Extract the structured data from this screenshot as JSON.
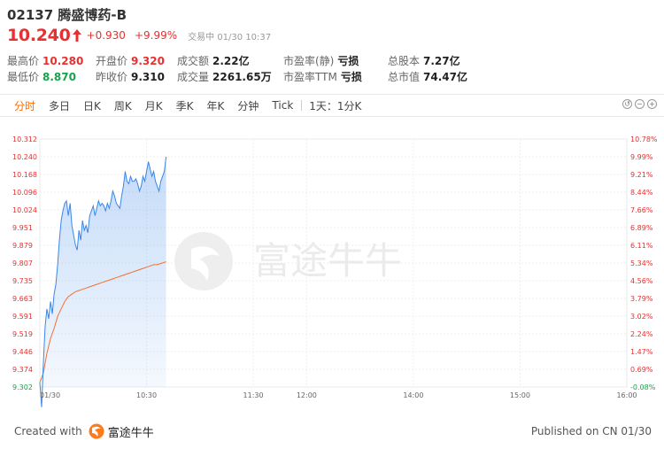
{
  "stock": {
    "code": "02137",
    "name": "腾盛博药-B",
    "price": "10.240",
    "change": "+0.930",
    "change_pct": "+9.99%",
    "status": "交易中 01/30 10:37"
  },
  "stats": {
    "high_label": "最高价",
    "high": "10.280",
    "open_label": "开盘价",
    "open": "9.320",
    "turnover_label": "成交额",
    "turnover": "2.22亿",
    "pe_static_label": "市盈率(静)",
    "pe_static": "亏损",
    "shares_label": "总股本",
    "shares": "7.27亿",
    "low_label": "最低价",
    "low": "8.870",
    "prev_close_label": "昨收价",
    "prev_close": "9.310",
    "volume_label": "成交量",
    "volume": "2261.65万",
    "pe_ttm_label": "市盈率TTM",
    "pe_ttm": "亏损",
    "mktcap_label": "总市值",
    "mktcap": "74.47亿"
  },
  "tabs": [
    {
      "label": "分时",
      "active": true
    },
    {
      "label": "多日"
    },
    {
      "label": "日K"
    },
    {
      "label": "周K"
    },
    {
      "label": "月K"
    },
    {
      "label": "季K"
    },
    {
      "label": "年K"
    },
    {
      "label": "分钟"
    },
    {
      "label": "Tick"
    }
  ],
  "interval_label": "1天：1分K",
  "watermark": "富途牛牛",
  "footer": {
    "created_with": "Created with",
    "brand": "富途牛牛",
    "published": "Published on CN 01/30"
  },
  "colors": {
    "up": "#e83030",
    "down": "#17a34a",
    "price_line": "#3a86e8",
    "avg_line": "#f07030",
    "accent": "#ff6a00"
  },
  "chart_data": {
    "type": "line",
    "left_ticks": [
      "10.312",
      "10.240",
      "10.168",
      "10.096",
      "10.024",
      "9.951",
      "9.879",
      "9.807",
      "9.735",
      "9.663",
      "9.591",
      "9.519",
      "9.446",
      "9.374",
      "9.302"
    ],
    "right_ticks": [
      "10.78%",
      "9.99%",
      "9.21%",
      "8.44%",
      "7.66%",
      "6.89%",
      "6.11%",
      "5.34%",
      "4.56%",
      "3.79%",
      "3.02%",
      "2.24%",
      "1.47%",
      "0.69%",
      "-0.08%"
    ],
    "x_ticks": [
      "01/30",
      "10:30",
      "11:30",
      "12:00",
      "14:00",
      "15:00",
      "16:00"
    ],
    "ylim": [
      9.302,
      10.312
    ],
    "series": [
      {
        "type": "price",
        "points": [
          [
            0,
            9.32
          ],
          [
            1,
            9.22
          ],
          [
            2,
            9.4
          ],
          [
            3,
            9.55
          ],
          [
            4,
            9.62
          ],
          [
            5,
            9.58
          ],
          [
            6,
            9.65
          ],
          [
            7,
            9.6
          ],
          [
            8,
            9.68
          ],
          [
            9,
            9.72
          ],
          [
            10,
            9.8
          ],
          [
            11,
            9.9
          ],
          [
            12,
            9.98
          ],
          [
            13,
            10.02
          ],
          [
            14,
            10.05
          ],
          [
            15,
            10.06
          ],
          [
            16,
            10.0
          ],
          [
            17,
            10.05
          ],
          [
            18,
            9.96
          ],
          [
            19,
            9.92
          ],
          [
            20,
            9.88
          ],
          [
            21,
            9.86
          ],
          [
            22,
            9.94
          ],
          [
            23,
            9.9
          ],
          [
            24,
            9.98
          ],
          [
            25,
            9.94
          ],
          [
            26,
            9.96
          ],
          [
            27,
            9.93
          ],
          [
            28,
            10.0
          ],
          [
            29,
            10.02
          ],
          [
            30,
            10.04
          ],
          [
            31,
            10.0
          ],
          [
            32,
            10.03
          ],
          [
            33,
            10.06
          ],
          [
            34,
            10.04
          ],
          [
            35,
            10.05
          ],
          [
            36,
            10.04
          ],
          [
            37,
            10.02
          ],
          [
            38,
            10.05
          ],
          [
            39,
            10.03
          ],
          [
            40,
            10.06
          ],
          [
            41,
            10.1
          ],
          [
            42,
            10.08
          ],
          [
            43,
            10.05
          ],
          [
            44,
            10.04
          ],
          [
            45,
            10.03
          ],
          [
            46,
            10.08
          ],
          [
            47,
            10.12
          ],
          [
            48,
            10.18
          ],
          [
            49,
            10.14
          ],
          [
            50,
            10.13
          ],
          [
            51,
            10.16
          ],
          [
            52,
            10.14
          ],
          [
            53,
            10.14
          ],
          [
            54,
            10.15
          ],
          [
            55,
            10.13
          ],
          [
            56,
            10.1
          ],
          [
            57,
            10.12
          ],
          [
            58,
            10.16
          ],
          [
            59,
            10.14
          ],
          [
            60,
            10.18
          ],
          [
            61,
            10.22
          ],
          [
            62,
            10.19
          ],
          [
            63,
            10.16
          ],
          [
            64,
            10.18
          ],
          [
            65,
            10.14
          ],
          [
            66,
            10.12
          ],
          [
            67,
            10.1
          ],
          [
            68,
            10.14
          ],
          [
            69,
            10.16
          ],
          [
            70,
            10.18
          ],
          [
            71,
            10.24
          ]
        ],
        "color": "#3a86e8"
      },
      {
        "type": "average",
        "points": [
          [
            0,
            9.32
          ],
          [
            2,
            9.36
          ],
          [
            4,
            9.44
          ],
          [
            6,
            9.5
          ],
          [
            8,
            9.54
          ],
          [
            10,
            9.59
          ],
          [
            12,
            9.62
          ],
          [
            14,
            9.65
          ],
          [
            16,
            9.67
          ],
          [
            18,
            9.68
          ],
          [
            20,
            9.69
          ],
          [
            22,
            9.695
          ],
          [
            24,
            9.7
          ],
          [
            26,
            9.705
          ],
          [
            28,
            9.71
          ],
          [
            30,
            9.715
          ],
          [
            32,
            9.72
          ],
          [
            34,
            9.725
          ],
          [
            36,
            9.73
          ],
          [
            38,
            9.735
          ],
          [
            40,
            9.74
          ],
          [
            42,
            9.745
          ],
          [
            44,
            9.75
          ],
          [
            46,
            9.755
          ],
          [
            48,
            9.76
          ],
          [
            50,
            9.765
          ],
          [
            52,
            9.77
          ],
          [
            54,
            9.775
          ],
          [
            56,
            9.78
          ],
          [
            58,
            9.785
          ],
          [
            60,
            9.79
          ],
          [
            62,
            9.795
          ],
          [
            64,
            9.8
          ],
          [
            66,
            9.8
          ],
          [
            68,
            9.805
          ],
          [
            70,
            9.81
          ],
          [
            71,
            9.812
          ]
        ],
        "color": "#f07030"
      }
    ]
  }
}
